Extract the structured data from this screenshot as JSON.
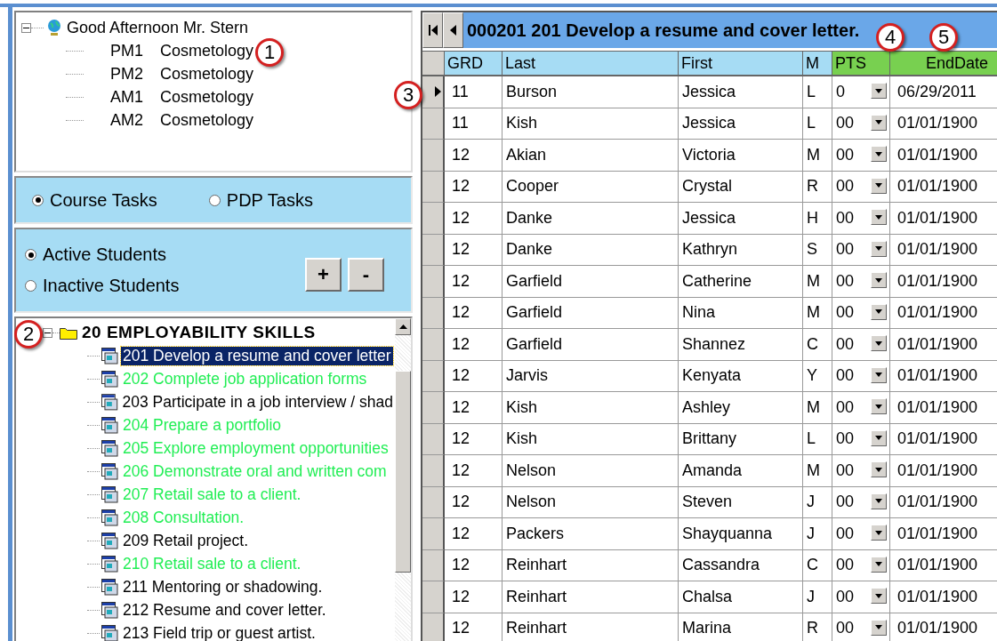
{
  "class_tree": {
    "root": "Good Afternoon Mr. Stern",
    "expanded": true,
    "children": [
      {
        "period": "PM1",
        "course": "Cosmetology"
      },
      {
        "period": "PM2",
        "course": "Cosmetology"
      },
      {
        "period": "AM1",
        "course": "Cosmetology"
      },
      {
        "period": "AM2",
        "course": "Cosmetology"
      }
    ]
  },
  "task_type": [
    {
      "label": "Course Tasks",
      "selected": true
    },
    {
      "label": "PDP Tasks",
      "selected": false
    }
  ],
  "student_filter": [
    {
      "label": "Active Students",
      "selected": true
    },
    {
      "label": "Inactive Students",
      "selected": false
    }
  ],
  "buttons": [
    "+",
    "-"
  ],
  "task_tree": {
    "label": "20 EMPLOYABILITY SKILLS",
    "expanded": true,
    "children": [
      {
        "label": "201 Develop a resume and cover letter",
        "selected": true
      },
      {
        "label": "202 Complete job application forms",
        "selected": false,
        "color": "#22ee55"
      },
      {
        "label": "203 Participate in a job interview / shad",
        "selected": false,
        "color": "#000000"
      },
      {
        "label": "204 Prepare a portfolio",
        "selected": false,
        "color": "#22ee55"
      },
      {
        "label": "205 Explore employment opportunities",
        "selected": false,
        "color": "#22ee55"
      },
      {
        "label": "206 Demonstrate oral and written com",
        "selected": false,
        "color": "#22ee55"
      },
      {
        "label": "207 Retail sale to a client.",
        "selected": false,
        "color": "#22ee55"
      },
      {
        "label": "208 Consultation.",
        "selected": false,
        "color": "#22ee55"
      },
      {
        "label": "209 Retail project.",
        "selected": false,
        "color": "#000000"
      },
      {
        "label": "210 Retail sale to a client.",
        "selected": false,
        "color": "#22ee55"
      },
      {
        "label": "211 Mentoring or shadowing.",
        "selected": false,
        "color": "#000000"
      },
      {
        "label": "212 Resume and cover letter.",
        "selected": false,
        "color": "#000000"
      },
      {
        "label": "213 Field trip or guest artist.",
        "selected": false,
        "color": "#000000"
      }
    ]
  },
  "grid": {
    "title": "000201 201 Develop a resume and cover letter.",
    "columns": [
      {
        "label": "GRD",
        "kind": "plain"
      },
      {
        "label": "Last",
        "kind": "plain"
      },
      {
        "label": "First",
        "kind": "plain"
      },
      {
        "label": "M",
        "kind": "plain"
      },
      {
        "label": "PTS",
        "kind": "edit"
      },
      {
        "label": "EndDate",
        "kind": "edit"
      }
    ],
    "rows": [
      {
        "selected": true,
        "cells": [
          "11",
          "Burson",
          "Jessica",
          "L",
          "0",
          "06/29/2011"
        ]
      },
      {
        "selected": false,
        "cells": [
          "11",
          "Kish",
          "Jessica",
          "L",
          "00",
          "01/01/1900"
        ]
      },
      {
        "selected": false,
        "cells": [
          "12",
          "Akian",
          "Victoria",
          "M",
          "00",
          "01/01/1900"
        ]
      },
      {
        "selected": false,
        "cells": [
          "12",
          "Cooper",
          "Crystal",
          "R",
          "00",
          "01/01/1900"
        ]
      },
      {
        "selected": false,
        "cells": [
          "12",
          "Danke",
          "Jessica",
          "H",
          "00",
          "01/01/1900"
        ]
      },
      {
        "selected": false,
        "cells": [
          "12",
          "Danke",
          "Kathryn",
          "S",
          "00",
          "01/01/1900"
        ]
      },
      {
        "selected": false,
        "cells": [
          "12",
          "Garfield",
          "Catherine",
          "M",
          "00",
          "01/01/1900"
        ]
      },
      {
        "selected": false,
        "cells": [
          "12",
          "Garfield",
          "Nina",
          "M",
          "00",
          "01/01/1900"
        ]
      },
      {
        "selected": false,
        "cells": [
          "12",
          "Garfield",
          "Shannez",
          "C",
          "00",
          "01/01/1900"
        ]
      },
      {
        "selected": false,
        "cells": [
          "12",
          "Jarvis",
          "Kenyata",
          "Y",
          "00",
          "01/01/1900"
        ]
      },
      {
        "selected": false,
        "cells": [
          "12",
          "Kish",
          "Ashley",
          "M",
          "00",
          "01/01/1900"
        ]
      },
      {
        "selected": false,
        "cells": [
          "12",
          "Kish",
          "Brittany",
          "L",
          "00",
          "01/01/1900"
        ]
      },
      {
        "selected": false,
        "cells": [
          "12",
          "Nelson",
          "Amanda",
          "M",
          "00",
          "01/01/1900"
        ]
      },
      {
        "selected": false,
        "cells": [
          "12",
          "Nelson",
          "Steven",
          "J",
          "00",
          "01/01/1900"
        ]
      },
      {
        "selected": false,
        "cells": [
          "12",
          "Packers",
          "Shayquanna",
          "J",
          "00",
          "01/01/1900"
        ]
      },
      {
        "selected": false,
        "cells": [
          "12",
          "Reinhart",
          "Cassandra",
          "C",
          "00",
          "01/01/1900"
        ]
      },
      {
        "selected": false,
        "cells": [
          "12",
          "Reinhart",
          "Chalsa",
          "J",
          "00",
          "01/01/1900"
        ]
      },
      {
        "selected": false,
        "cells": [
          "12",
          "Reinhart",
          "Marina",
          "R",
          "00",
          "01/01/1900"
        ]
      }
    ]
  },
  "callouts": [
    "1",
    "2",
    "3",
    "4",
    "5"
  ]
}
